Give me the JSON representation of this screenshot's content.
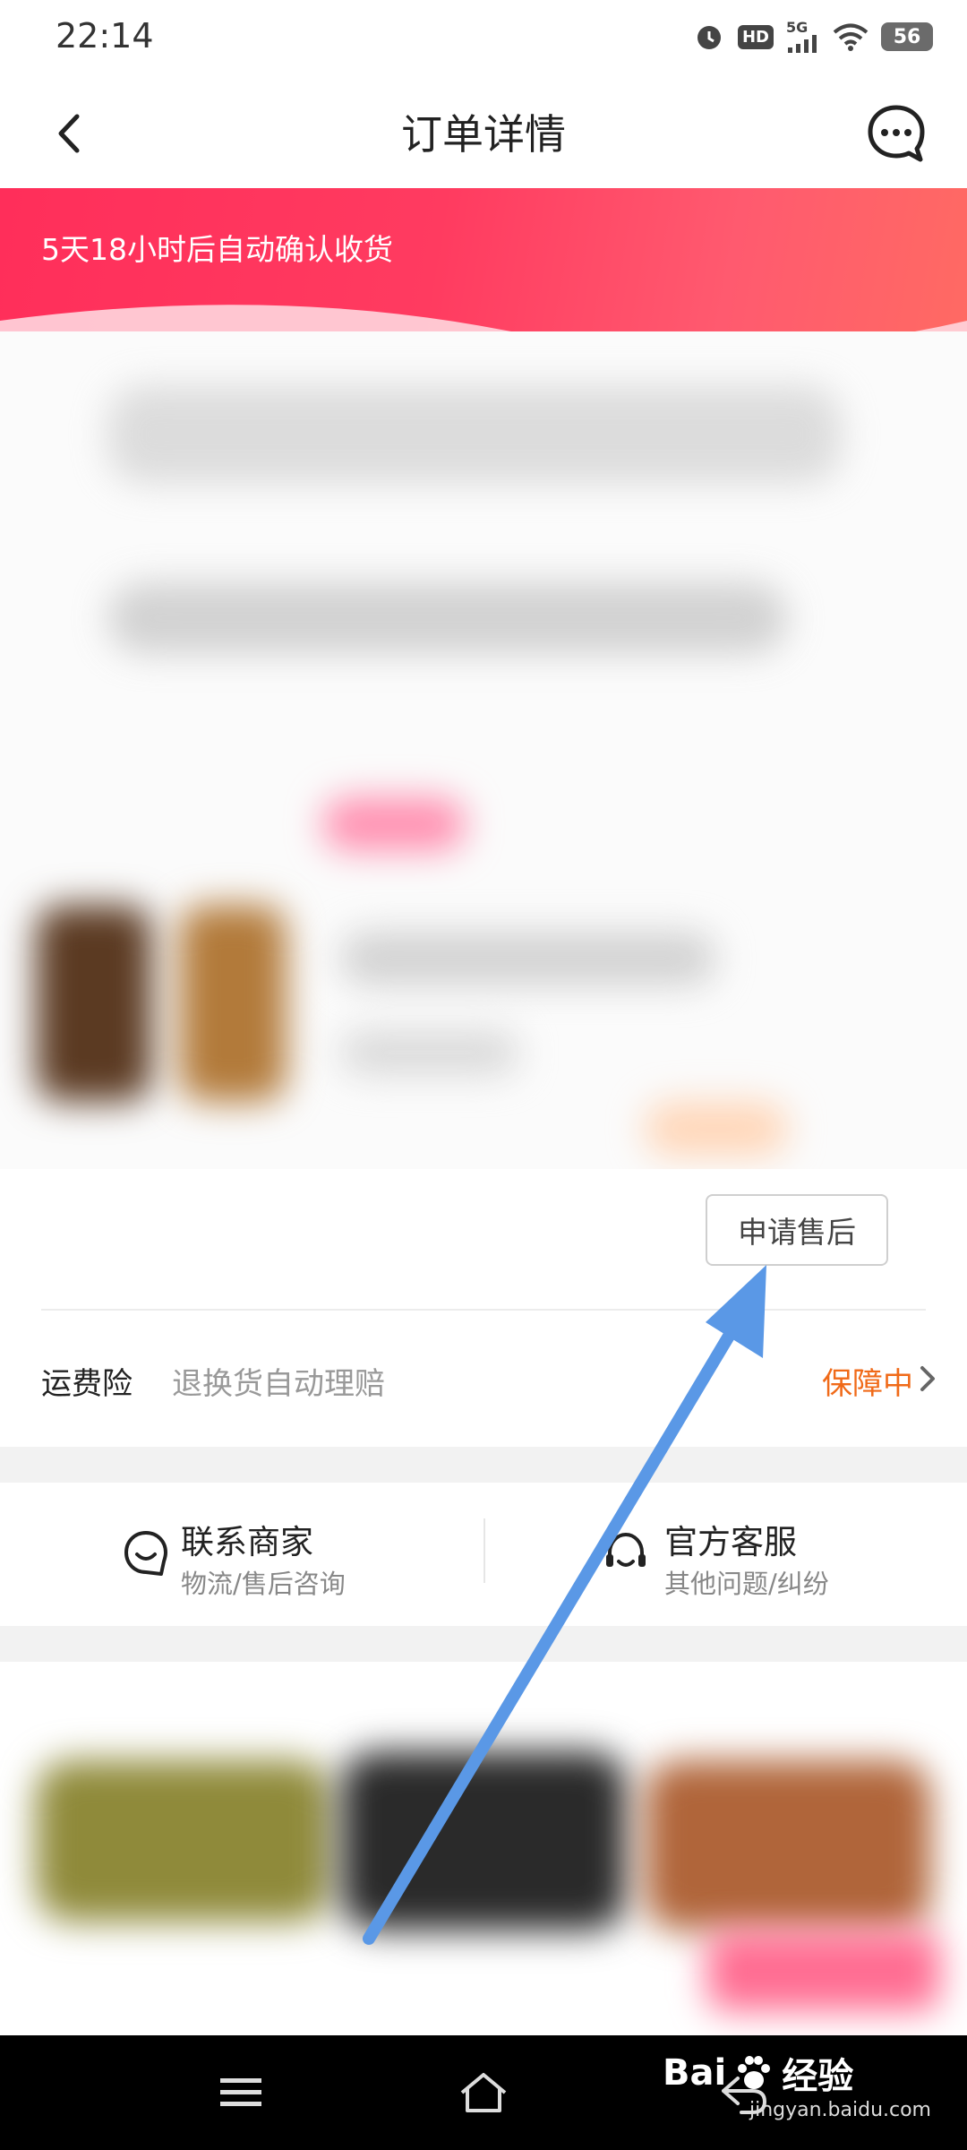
{
  "status_bar": {
    "time": "22:14",
    "network": "5G",
    "hd": "HD",
    "battery": "56",
    "icons": [
      "alarm-icon",
      "hd-icon",
      "5g-signal-icon",
      "wifi-icon",
      "battery-icon"
    ]
  },
  "header": {
    "title": "订单详情",
    "back_icon": "back-chevron-icon",
    "chat_icon": "chat-bubble-icon"
  },
  "order_status": {
    "subtitle": "5天18小时后自动确认收货",
    "accent": "#ff3b60"
  },
  "order_card": {
    "after_sale_button": "申请售后"
  },
  "shipping_insurance": {
    "label": "运费险",
    "description": "退换货自动理赔",
    "status": "保障中",
    "status_color": "#f06a18"
  },
  "contact": {
    "merchant": {
      "title": "联系商家",
      "subtitle": "物流/售后咨询",
      "icon": "chat-smile-icon"
    },
    "official": {
      "title": "官方客服",
      "subtitle": "其他问题/纠纷",
      "icon": "headset-icon"
    }
  },
  "watermark": {
    "brand": "Bai",
    "brand_suffix": "经验",
    "url": "jingyan.baidu.com"
  },
  "system_nav": {
    "icons": [
      "menu-icon",
      "home-icon",
      "back-icon"
    ]
  },
  "annotation": {
    "arrow_color": "#5a98e6",
    "points_to": "after-sale-button"
  }
}
